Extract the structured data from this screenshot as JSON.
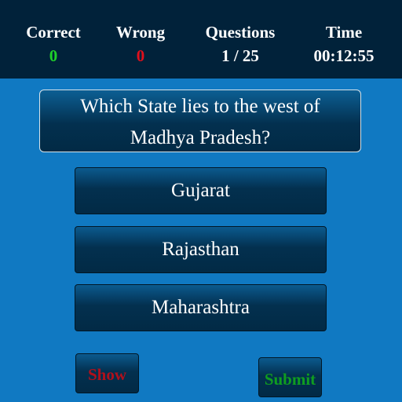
{
  "stats": {
    "correct": {
      "label": "Correct",
      "value": "0",
      "color": "#1fd12a"
    },
    "wrong": {
      "label": "Wrong",
      "value": "0",
      "color": "#e0101c"
    },
    "questions": {
      "label": "Questions",
      "value": "1 / 25"
    },
    "time": {
      "label": "Time",
      "value": "00:12:55"
    }
  },
  "question": {
    "line1": "Which State lies to the west of",
    "line2": "Madhya Pradesh?"
  },
  "options": [
    "Gujarat",
    "Rajasthan",
    "Maharashtra"
  ],
  "actions": {
    "show_label": "Show",
    "submit_label": "Submit"
  },
  "colors": {
    "background": "#1079c2",
    "top_bar": "#01223a",
    "show_text": "#b0101c",
    "submit_text": "#0f9d20"
  }
}
